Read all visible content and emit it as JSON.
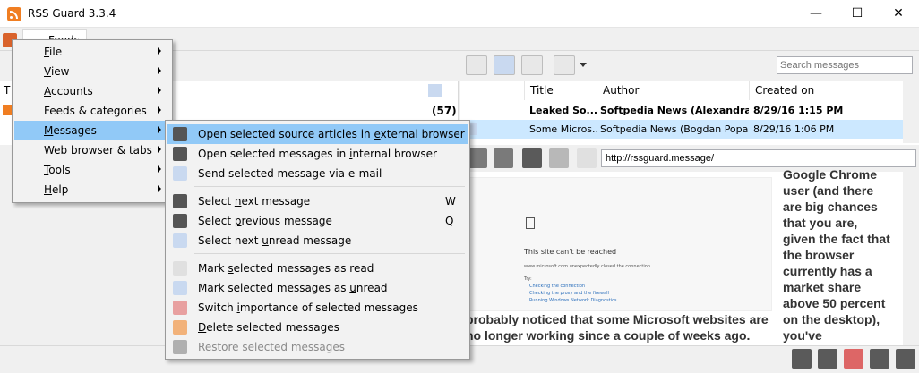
{
  "window": {
    "title": "RSS Guard 3.3.4",
    "minimize": "—",
    "maximize": "☐",
    "close": "✕"
  },
  "tabs": {
    "feeds": "Feeds"
  },
  "search": {
    "placeholder": "Search messages"
  },
  "feed_list": {
    "header_letter": "T",
    "unread_count": "(57)"
  },
  "message_list": {
    "columns": [
      "Title",
      "Author",
      "Created on"
    ],
    "rows": [
      {
        "title": "Leaked So...",
        "author": "Softpedia News (Alexandra...",
        "created": "8/29/16 1:15 PM",
        "bold": true,
        "selected": false
      },
      {
        "title": "Some Micros...",
        "author": "Softpedia News (Bogdan Popa)",
        "created": "8/29/16 1:06 PM",
        "bold": false,
        "selected": true
      }
    ]
  },
  "browser": {
    "url": "http://rssguard.message/"
  },
  "article": {
    "side_text": "Google Chrome user (and there are big chances that you are, given the fact that the browser currently has a market share above 50 percent on the desktop), you've",
    "bottom_text": "probably noticed that some Microsoft websites are no longer working since a couple of weeks ago.",
    "screenshot_heading": "This site can't be reached",
    "screenshot_detail": "www.microsoft.com unexpectedly closed the connection.",
    "screenshot_try": "Try:",
    "screenshot_bullets": [
      "Checking the connection",
      "Checking the proxy and the firewall",
      "Running Windows Network Diagnostics"
    ]
  },
  "main_menu": {
    "items": [
      {
        "label": "File",
        "mnemonic": "F",
        "rest": "ile"
      },
      {
        "label": "View",
        "mnemonic": "V",
        "rest": "iew"
      },
      {
        "label": "Accounts",
        "mnemonic": "A",
        "rest": "ccounts"
      },
      {
        "label": "Feeds & categories",
        "mnemonic": "",
        "rest": "Feeds & categories"
      },
      {
        "label": "Messages",
        "mnemonic": "M",
        "rest": "essages"
      },
      {
        "label": "Web browser & tabs",
        "mnemonic": "",
        "rest": "Web browser & tabs"
      },
      {
        "label": "Tools",
        "mnemonic": "T",
        "rest": "ools"
      },
      {
        "label": "Help",
        "mnemonic": "H",
        "rest": "elp"
      }
    ],
    "selected": "Messages"
  },
  "messages_submenu": {
    "items": [
      {
        "pre": "Open selected source articles in ",
        "u": "e",
        "post": "xternal browser",
        "shortcut": "",
        "selected": true,
        "disabled": false,
        "icon": "browser-icon"
      },
      {
        "pre": "Open selected messages in ",
        "u": "i",
        "post": "nternal browser",
        "shortcut": "",
        "selected": false,
        "disabled": false,
        "icon": "browser-icon"
      },
      {
        "pre": "Send selected message via e-mail",
        "u": "",
        "post": "",
        "shortcut": "",
        "selected": false,
        "disabled": false,
        "icon": "mail-send-icon"
      },
      {
        "pre": "Select ",
        "u": "n",
        "post": "ext message",
        "shortcut": "W",
        "selected": false,
        "disabled": false,
        "icon": "arrow-down-icon"
      },
      {
        "pre": "Select ",
        "u": "p",
        "post": "revious message",
        "shortcut": "Q",
        "selected": false,
        "disabled": false,
        "icon": "arrow-up-icon"
      },
      {
        "pre": "Select next ",
        "u": "u",
        "post": "nread message",
        "shortcut": "",
        "selected": false,
        "disabled": false,
        "icon": "unread-icon"
      },
      {
        "pre": "Mark ",
        "u": "s",
        "post": "elected messages as read",
        "shortcut": "",
        "selected": false,
        "disabled": false,
        "icon": "read-icon"
      },
      {
        "pre": "Mark selected messages as ",
        "u": "u",
        "post": "nread",
        "shortcut": "",
        "selected": false,
        "disabled": false,
        "icon": "unread-icon"
      },
      {
        "pre": "Switch ",
        "u": "i",
        "post": "mportance of selected messages",
        "shortcut": "",
        "selected": false,
        "disabled": false,
        "icon": "important-icon"
      },
      {
        "pre": "",
        "u": "D",
        "post": "elete selected messages",
        "shortcut": "",
        "selected": false,
        "disabled": false,
        "icon": "delete-icon"
      },
      {
        "pre": "",
        "u": "R",
        "post": "estore selected messages",
        "shortcut": "",
        "selected": false,
        "disabled": true,
        "icon": "restore-icon"
      }
    ]
  },
  "colors": {
    "menu_highlight": "#91c9f7",
    "selected_row": "#cce8ff",
    "accent_orange": "#f07e22"
  }
}
